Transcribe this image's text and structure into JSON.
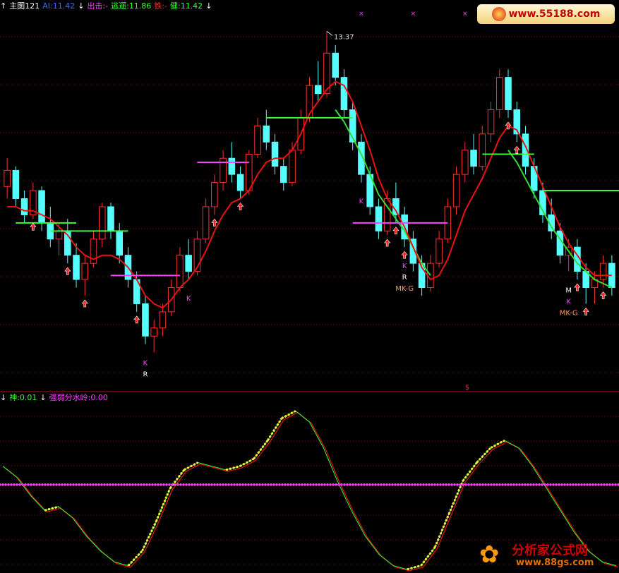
{
  "main_header": {
    "up_icon": "up-arrow-icon",
    "title": "主图121",
    "ai": "AI:11.42",
    "down_icon": "down-arrow-icon",
    "chuji": "出击:-",
    "taoyi": "逃逦:11.86",
    "tie": "铁:-",
    "jian": "健:11.42",
    "colors": {
      "title": "#ffffff",
      "ai": "#3b6cff",
      "chuji": "#ff40ff",
      "taoyi": "#33ff33",
      "tie": "#ff3030",
      "jian": "#33ff33"
    }
  },
  "osc_header": {
    "shen": "神:0.01",
    "line": "强弱分水岭:0.00",
    "colors": {
      "shen": "#33ff33",
      "line": "#ff40ff"
    }
  },
  "watermark_top": {
    "text": "www.55188.com"
  },
  "watermark_bottom": {
    "cn": "分析家公式网",
    "url": "www.88gs.com",
    "icon": "flower-logo-icon"
  },
  "chart_data": [
    {
      "type": "candlestick",
      "ylim": [
        9.0,
        13.6
      ],
      "grid": "dotted-horizontal",
      "max_label": "13.37",
      "candles": [
        [
          11.45,
          11.8,
          11.3,
          11.65
        ],
        [
          11.65,
          11.7,
          11.2,
          11.3
        ],
        [
          11.3,
          11.4,
          11.0,
          11.1
        ],
        [
          11.1,
          11.5,
          11.05,
          11.4
        ],
        [
          11.4,
          11.45,
          10.9,
          11.0
        ],
        [
          11.0,
          11.2,
          10.7,
          10.8
        ],
        [
          10.8,
          11.0,
          10.6,
          10.9
        ],
        [
          10.9,
          11.05,
          10.5,
          10.6
        ],
        [
          10.6,
          10.75,
          10.2,
          10.3
        ],
        [
          10.3,
          10.6,
          10.1,
          10.5
        ],
        [
          10.5,
          10.9,
          10.45,
          10.8
        ],
        [
          10.8,
          11.25,
          10.7,
          11.2
        ],
        [
          11.2,
          11.25,
          10.8,
          10.9
        ],
        [
          10.9,
          11.0,
          10.5,
          10.6
        ],
        [
          10.6,
          10.7,
          10.2,
          10.3
        ],
        [
          10.3,
          10.4,
          9.9,
          10.0
        ],
        [
          10.0,
          10.1,
          9.5,
          9.6
        ],
        [
          9.6,
          9.8,
          9.4,
          9.7
        ],
        [
          9.7,
          10.0,
          9.6,
          9.9
        ],
        [
          9.9,
          10.3,
          9.85,
          10.2
        ],
        [
          10.2,
          10.7,
          10.15,
          10.6
        ],
        [
          10.6,
          10.8,
          10.3,
          10.4
        ],
        [
          10.4,
          10.9,
          10.35,
          10.8
        ],
        [
          10.8,
          11.3,
          10.75,
          11.2
        ],
        [
          11.2,
          11.6,
          11.1,
          11.5
        ],
        [
          11.5,
          11.9,
          11.4,
          11.8
        ],
        [
          11.8,
          12.0,
          11.5,
          11.6
        ],
        [
          11.6,
          11.7,
          11.3,
          11.4
        ],
        [
          11.4,
          11.9,
          11.35,
          11.85
        ],
        [
          11.85,
          12.3,
          11.8,
          12.2
        ],
        [
          12.2,
          12.4,
          11.9,
          12.0
        ],
        [
          12.0,
          12.1,
          11.6,
          11.7
        ],
        [
          11.7,
          11.8,
          11.4,
          11.5
        ],
        [
          11.5,
          12.0,
          11.45,
          11.9
        ],
        [
          11.9,
          12.4,
          11.85,
          12.3
        ],
        [
          12.3,
          12.8,
          12.25,
          12.7
        ],
        [
          12.7,
          13.0,
          12.5,
          12.6
        ],
        [
          12.6,
          13.37,
          12.55,
          13.1
        ],
        [
          13.1,
          13.2,
          12.7,
          12.8
        ],
        [
          12.8,
          12.9,
          12.3,
          12.4
        ],
        [
          12.4,
          12.5,
          11.9,
          12.0
        ],
        [
          12.0,
          12.1,
          11.5,
          11.6
        ],
        [
          11.6,
          11.7,
          11.1,
          11.2
        ],
        [
          11.2,
          11.3,
          10.8,
          10.9
        ],
        [
          10.9,
          11.4,
          10.85,
          11.3
        ],
        [
          11.3,
          11.5,
          11.0,
          11.1
        ],
        [
          11.1,
          11.2,
          10.7,
          10.8
        ],
        [
          10.8,
          10.9,
          10.4,
          10.5
        ],
        [
          10.5,
          10.6,
          10.1,
          10.2
        ],
        [
          10.2,
          10.6,
          10.15,
          10.5
        ],
        [
          10.5,
          10.9,
          10.45,
          10.8
        ],
        [
          10.8,
          11.3,
          10.75,
          11.2
        ],
        [
          11.2,
          11.7,
          11.1,
          11.6
        ],
        [
          11.6,
          12.0,
          11.5,
          11.9
        ],
        [
          11.9,
          12.1,
          11.6,
          11.7
        ],
        [
          11.7,
          12.2,
          11.65,
          12.1
        ],
        [
          12.1,
          12.5,
          12.0,
          12.4
        ],
        [
          12.4,
          12.9,
          12.3,
          12.8
        ],
        [
          12.8,
          12.9,
          12.3,
          12.4
        ],
        [
          12.4,
          12.5,
          12.0,
          12.1
        ],
        [
          12.1,
          12.2,
          11.6,
          11.7
        ],
        [
          11.7,
          11.8,
          11.3,
          11.4
        ],
        [
          11.4,
          11.5,
          11.0,
          11.1
        ],
        [
          11.1,
          11.3,
          10.8,
          10.9
        ],
        [
          10.9,
          11.0,
          10.5,
          10.6
        ],
        [
          10.6,
          10.8,
          10.4,
          10.7
        ],
        [
          10.7,
          10.8,
          10.3,
          10.4
        ],
        [
          10.4,
          10.5,
          10.0,
          10.2
        ],
        [
          10.2,
          10.4,
          10.0,
          10.3
        ],
        [
          10.3,
          10.6,
          10.2,
          10.5
        ],
        [
          10.5,
          10.6,
          10.1,
          10.2
        ]
      ],
      "ma_red": [
        11.2,
        11.2,
        11.15,
        11.15,
        11.1,
        11.05,
        10.95,
        10.85,
        10.7,
        10.6,
        10.55,
        10.6,
        10.6,
        10.55,
        10.45,
        10.3,
        10.1,
        10.0,
        9.95,
        10.05,
        10.2,
        10.3,
        10.45,
        10.65,
        10.9,
        11.1,
        11.25,
        11.3,
        11.4,
        11.6,
        11.75,
        11.8,
        11.8,
        11.9,
        12.1,
        12.35,
        12.5,
        12.65,
        12.75,
        12.7,
        12.5,
        12.2,
        11.9,
        11.55,
        11.3,
        11.15,
        10.95,
        10.7,
        10.45,
        10.3,
        10.35,
        10.55,
        10.85,
        11.15,
        11.35,
        11.55,
        11.8,
        12.05,
        12.2,
        12.15,
        11.95,
        11.7,
        11.45,
        11.2,
        10.95,
        10.75,
        10.6,
        10.45,
        10.35,
        10.35,
        10.35
      ],
      "ma_green": [
        null,
        null,
        null,
        null,
        null,
        null,
        null,
        null,
        null,
        null,
        null,
        null,
        null,
        null,
        null,
        null,
        null,
        null,
        null,
        null,
        null,
        null,
        null,
        null,
        null,
        null,
        null,
        null,
        null,
        null,
        null,
        null,
        null,
        null,
        null,
        null,
        null,
        null,
        12.4,
        12.25,
        12.05,
        11.85,
        11.6,
        11.35,
        11.2,
        11.05,
        10.9,
        10.7,
        10.5,
        10.35,
        null,
        null,
        null,
        null,
        null,
        null,
        null,
        null,
        11.9,
        11.75,
        11.55,
        11.35,
        11.15,
        10.95,
        10.8,
        10.65,
        10.5,
        10.4,
        10.3,
        10.25,
        10.2
      ],
      "levels": [
        {
          "start": 1,
          "end": 8,
          "value": 11.0,
          "color": "#33ff33"
        },
        {
          "start": 5,
          "end": 14,
          "value": 10.9,
          "color": "#33ff33"
        },
        {
          "start": 12,
          "end": 20,
          "value": 10.35,
          "color": "#ff40ff"
        },
        {
          "start": 22,
          "end": 28,
          "value": 11.75,
          "color": "#ff40ff"
        },
        {
          "start": 30,
          "end": 40,
          "value": 12.3,
          "color": "#33ff33"
        },
        {
          "start": 40,
          "end": 51,
          "value": 11.0,
          "color": "#ff40ff"
        },
        {
          "start": 55,
          "end": 61,
          "value": 11.85,
          "color": "#33ff33"
        },
        {
          "start": 62,
          "end": 71,
          "value": 11.4,
          "color": "#33ff33"
        }
      ],
      "annotations": [
        {
          "i": 16,
          "text": "K",
          "color": "#ff40ff"
        },
        {
          "i": 16,
          "text": "R",
          "color": "#ffffff"
        },
        {
          "i": 21,
          "text": "K",
          "color": "#ff40ff"
        },
        {
          "i": 41,
          "text": "K",
          "color": "#ff40ff"
        },
        {
          "i": 46,
          "text": "K",
          "color": "#ff40ff"
        },
        {
          "i": 46,
          "text": "R",
          "color": "#ffffff"
        },
        {
          "i": 46,
          "text": "MK-G",
          "color": "#ff9966"
        },
        {
          "i": 65,
          "text": "M",
          "color": "#ffffff"
        },
        {
          "i": 65,
          "text": "K",
          "color": "#ff40ff"
        },
        {
          "i": 65,
          "text": "MK-G",
          "color": "#ff9966"
        }
      ],
      "buy_arrows": [
        3,
        7,
        9,
        15,
        24,
        27,
        44,
        45,
        46,
        58,
        59,
        66,
        67,
        69
      ],
      "top_markers": [
        {
          "i": 41,
          "text": "×"
        },
        {
          "i": 47,
          "text": "×"
        },
        {
          "i": 53,
          "text": "×"
        },
        {
          "i": 55,
          "text": "×"
        },
        {
          "i": 59,
          "text": "×"
        }
      ]
    },
    {
      "type": "line",
      "ylim": [
        -1.2,
        1.1
      ],
      "series": [
        {
          "name": "神",
          "color": "#33ff33",
          "values": [
            0.25,
            0.1,
            -0.15,
            -0.35,
            -0.3,
            -0.45,
            -0.7,
            -0.9,
            -1.05,
            -1.1,
            -0.9,
            -0.5,
            -0.05,
            0.2,
            0.3,
            0.25,
            0.2,
            0.25,
            0.35,
            0.6,
            0.9,
            1.0,
            0.85,
            0.5,
            0.05,
            -0.35,
            -0.7,
            -0.95,
            -1.1,
            -1.15,
            -1.1,
            -0.85,
            -0.4,
            0.05,
            0.3,
            0.5,
            0.6,
            0.5,
            0.25,
            -0.05,
            -0.35,
            -0.65,
            -0.9,
            -1.05,
            -1.1
          ]
        },
        {
          "name": "强弱分水岭",
          "color": "#ff40ff",
          "values": [
            0,
            0,
            0,
            0,
            0,
            0,
            0,
            0,
            0,
            0,
            0,
            0,
            0,
            0,
            0,
            0,
            0,
            0,
            0,
            0,
            0,
            0,
            0,
            0,
            0,
            0,
            0,
            0,
            0,
            0,
            0,
            0,
            0,
            0,
            0,
            0,
            0,
            0,
            0,
            0,
            0,
            0,
            0,
            0,
            0
          ]
        }
      ]
    }
  ]
}
